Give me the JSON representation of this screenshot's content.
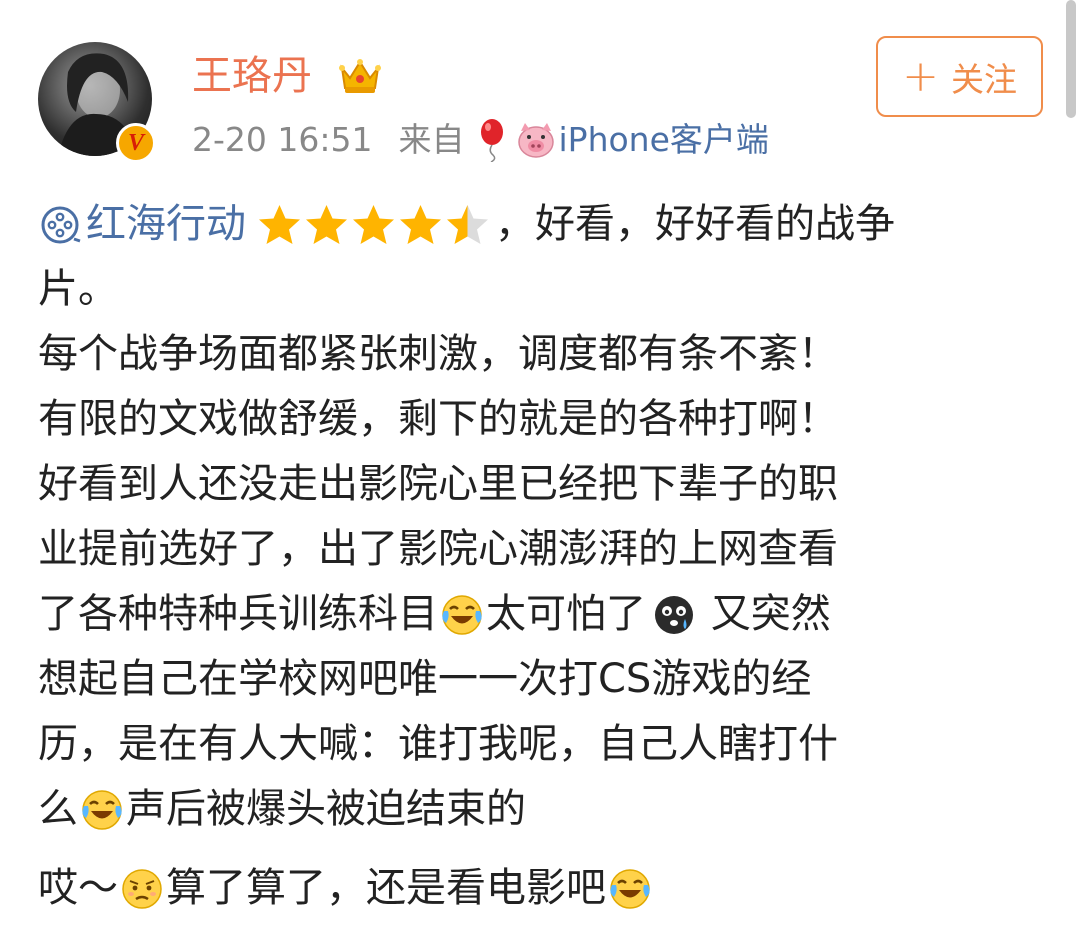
{
  "user": {
    "name": "王珞丹",
    "timestamp": "2-20 16:51",
    "source_prefix": "来自",
    "client": "iPhone客户端",
    "verified_badge": "V"
  },
  "follow_button": {
    "icon": "plus-icon",
    "label": "关注"
  },
  "post": {
    "topic": "红海行动",
    "rating_stars": 4.5,
    "lines": [
      {
        "text_after_rating": "，好看，好好看的战争"
      },
      "片。",
      "每个战争场面都紧张刺激，调度都有条不紊！",
      "有限的文戏做舒缓，剩下的就是的各种打啊！",
      "好看到人还没走出影院心里已经把下辈子的职",
      "业提前选好了，出了影院心潮澎湃的上网查看",
      {
        "a": "了各种特种兵训练科目",
        "b": "太可怕了",
        "c": " 又突然"
      },
      "想起自己在学校网吧唯一一次打CS游戏的经",
      "历，是在有人大喊：谁打我呢，自己人瞎打什",
      {
        "a": "么",
        "b": "声后被爆头被迫结束的"
      },
      {
        "a": "哎～",
        "b": "算了算了，还是看电影吧"
      }
    ]
  },
  "colors": {
    "username": "#eb7350",
    "link": "#4a6fa5",
    "meta": "#888888",
    "follow": "#f08d4b",
    "star": "#ffb400",
    "text": "#222222"
  },
  "icons": [
    "crown-icon",
    "balloon-icon",
    "pig-icon",
    "topic-movie-icon",
    "star-icon",
    "laugh-cry-emoji",
    "scared-emoji",
    "sad-emoji"
  ]
}
